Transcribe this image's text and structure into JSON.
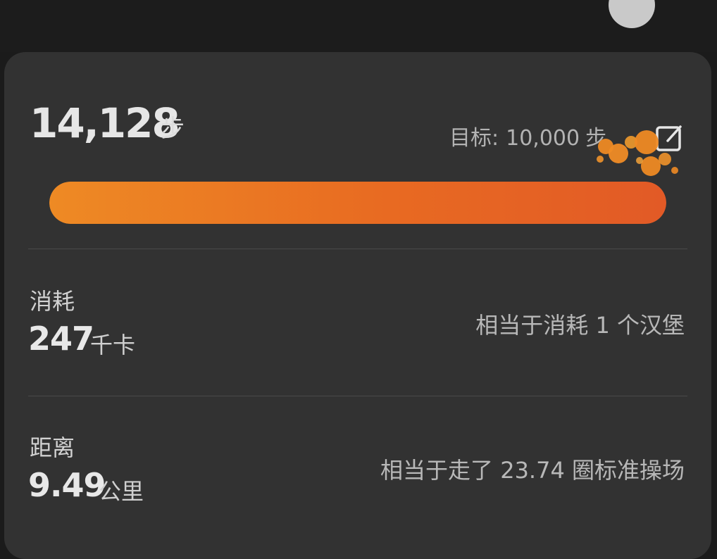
{
  "steps": {
    "value": "14,128",
    "unit": "步",
    "goal_label": "目标:",
    "goal_value": "10,000",
    "goal_unit": "步",
    "progress_fraction": 1.0,
    "icons": {
      "edit": "edit-icon"
    }
  },
  "calories": {
    "label": "消耗",
    "value": "247",
    "unit": "千卡",
    "note": "相当于消耗 1 个汉堡"
  },
  "distance": {
    "label": "距离",
    "value": "9.49",
    "unit": "公里",
    "note": "相当于走了 23.74 圈标准操场"
  },
  "colors": {
    "background": "#1b1b1b",
    "card": "#323232",
    "accent": "#e8702a"
  }
}
